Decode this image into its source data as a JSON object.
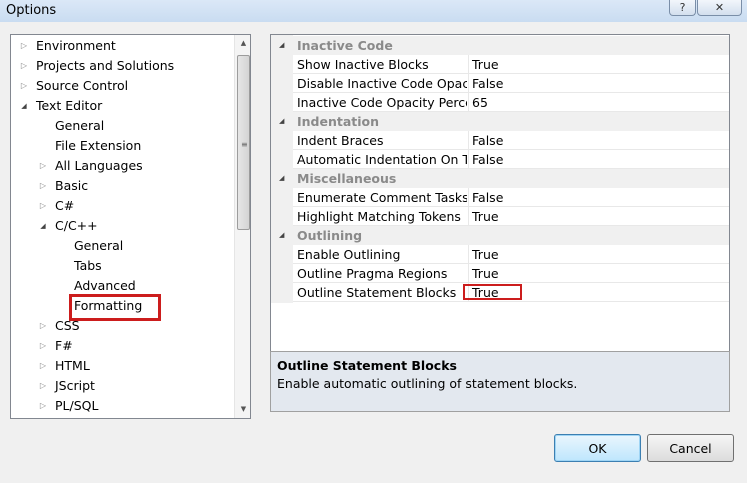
{
  "window": {
    "title": "Options",
    "help_glyph": "?",
    "close_glyph": "✕"
  },
  "tree": {
    "items": [
      {
        "label": "Environment",
        "level": 0,
        "arrow": "closed"
      },
      {
        "label": "Projects and Solutions",
        "level": 0,
        "arrow": "closed"
      },
      {
        "label": "Source Control",
        "level": 0,
        "arrow": "closed"
      },
      {
        "label": "Text Editor",
        "level": 0,
        "arrow": "open"
      },
      {
        "label": "General",
        "level": 1,
        "arrow": "none"
      },
      {
        "label": "File Extension",
        "level": 1,
        "arrow": "none"
      },
      {
        "label": "All Languages",
        "level": 1,
        "arrow": "closed"
      },
      {
        "label": "Basic",
        "level": 1,
        "arrow": "closed"
      },
      {
        "label": "C#",
        "level": 1,
        "arrow": "closed"
      },
      {
        "label": "C/C++",
        "level": 1,
        "arrow": "open"
      },
      {
        "label": "General",
        "level": 2,
        "arrow": "none"
      },
      {
        "label": "Tabs",
        "level": 2,
        "arrow": "none"
      },
      {
        "label": "Advanced",
        "level": 2,
        "arrow": "none"
      },
      {
        "label": "Formatting",
        "level": 2,
        "arrow": "none",
        "highlighted": true
      },
      {
        "label": "CSS",
        "level": 1,
        "arrow": "closed"
      },
      {
        "label": "F#",
        "level": 1,
        "arrow": "closed"
      },
      {
        "label": "HTML",
        "level": 1,
        "arrow": "closed"
      },
      {
        "label": "JScript",
        "level": 1,
        "arrow": "closed"
      },
      {
        "label": "PL/SQL",
        "level": 1,
        "arrow": "closed"
      }
    ]
  },
  "property_grid": {
    "categories": [
      {
        "label": "Inactive Code",
        "properties": [
          {
            "name": "Show Inactive Blocks",
            "value": "True"
          },
          {
            "name": "Disable Inactive Code Opacity",
            "value": "False"
          },
          {
            "name": "Inactive Code Opacity Percent",
            "value": "65"
          }
        ]
      },
      {
        "label": "Indentation",
        "properties": [
          {
            "name": "Indent Braces",
            "value": "False"
          },
          {
            "name": "Automatic Indentation On Tab",
            "value": "False"
          }
        ]
      },
      {
        "label": "Miscellaneous",
        "properties": [
          {
            "name": "Enumerate Comment Tasks",
            "value": "False"
          },
          {
            "name": "Highlight Matching Tokens",
            "value": "True"
          }
        ]
      },
      {
        "label": "Outlining",
        "properties": [
          {
            "name": "Enable Outlining",
            "value": "True"
          },
          {
            "name": "Outline Pragma Regions",
            "value": "True"
          },
          {
            "name": "Outline Statement Blocks",
            "value": "True",
            "highlighted": true
          }
        ]
      }
    ]
  },
  "description": {
    "title": "Outline Statement Blocks",
    "text": "Enable automatic outlining of statement blocks."
  },
  "buttons": {
    "ok_label": "OK",
    "cancel_label": "Cancel"
  },
  "colors": {
    "highlight": "#cc1d1d",
    "category_text": "#8a8a8a"
  }
}
